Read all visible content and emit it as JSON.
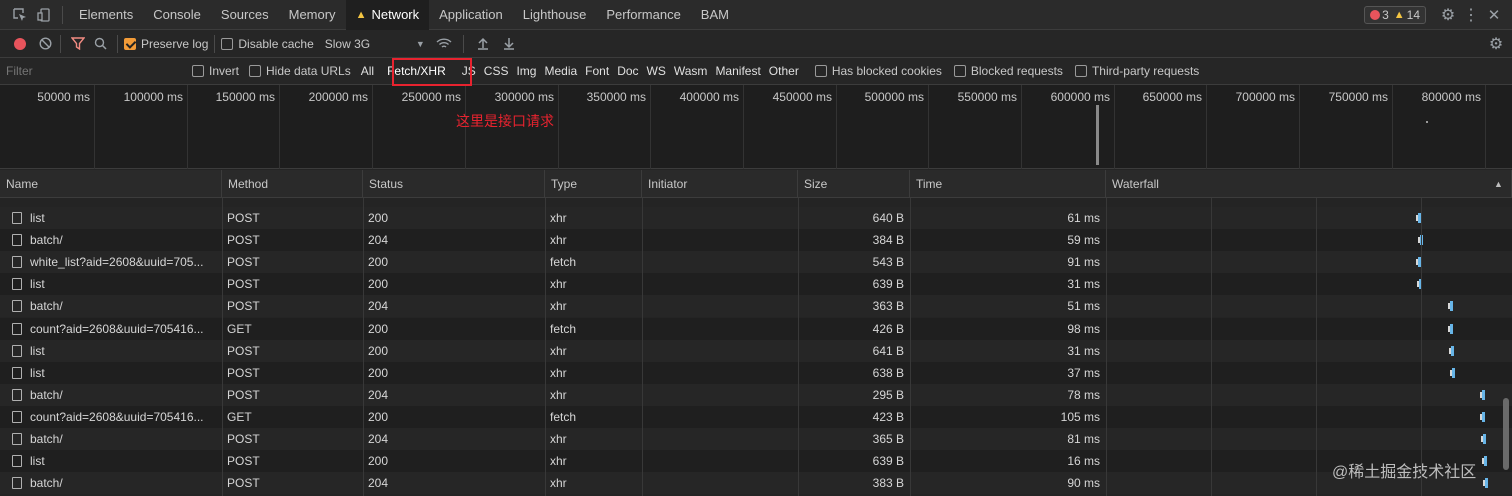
{
  "tabs": [
    "Elements",
    "Console",
    "Sources",
    "Memory",
    "Network",
    "Application",
    "Lighthouse",
    "Performance",
    "BAM"
  ],
  "active_tab": "Network",
  "badges": {
    "errors": "3",
    "warnings": "14"
  },
  "toolbar": {
    "preserve_log": "Preserve log",
    "disable_cache": "Disable cache",
    "throttle": "Slow 3G"
  },
  "filter": {
    "placeholder": "Filter",
    "invert": "Invert",
    "hide_data_urls": "Hide data URLs",
    "types": [
      "All",
      "Fetch/XHR",
      "JS",
      "CSS",
      "Img",
      "Media",
      "Font",
      "Doc",
      "WS",
      "Wasm",
      "Manifest",
      "Other"
    ],
    "selected_type": "Fetch/XHR",
    "has_blocked_cookies": "Has blocked cookies",
    "blocked_requests": "Blocked requests",
    "third_party": "Third-party requests"
  },
  "timeline_ticks": [
    "50000 ms",
    "100000 ms",
    "150000 ms",
    "200000 ms",
    "250000 ms",
    "300000 ms",
    "350000 ms",
    "400000 ms",
    "450000 ms",
    "500000 ms",
    "550000 ms",
    "600000 ms",
    "650000 ms",
    "700000 ms",
    "750000 ms",
    "800000 ms"
  ],
  "annotation": "这里是接口请求",
  "columns": [
    "Name",
    "Method",
    "Status",
    "Type",
    "Initiator",
    "Size",
    "Time",
    "Waterfall"
  ],
  "rows": [
    {
      "name": "list",
      "method": "POST",
      "status": "200",
      "type": "xhr",
      "initiator": "",
      "size": "640 B",
      "time": "61 ms"
    },
    {
      "name": "batch/",
      "method": "POST",
      "status": "204",
      "type": "xhr",
      "initiator": "",
      "size": "384 B",
      "time": "59 ms"
    },
    {
      "name": "white_list?aid=2608&uuid=705...",
      "method": "POST",
      "status": "200",
      "type": "fetch",
      "initiator": "",
      "size": "543 B",
      "time": "91 ms"
    },
    {
      "name": "list",
      "method": "POST",
      "status": "200",
      "type": "xhr",
      "initiator": "",
      "size": "639 B",
      "time": "31 ms"
    },
    {
      "name": "batch/",
      "method": "POST",
      "status": "204",
      "type": "xhr",
      "initiator": "",
      "size": "363 B",
      "time": "51 ms"
    },
    {
      "name": "count?aid=2608&uuid=705416...",
      "method": "GET",
      "status": "200",
      "type": "fetch",
      "initiator": "",
      "size": "426 B",
      "time": "98 ms"
    },
    {
      "name": "list",
      "method": "POST",
      "status": "200",
      "type": "xhr",
      "initiator": "",
      "size": "641 B",
      "time": "31 ms"
    },
    {
      "name": "list",
      "method": "POST",
      "status": "200",
      "type": "xhr",
      "initiator": "",
      "size": "638 B",
      "time": "37 ms"
    },
    {
      "name": "batch/",
      "method": "POST",
      "status": "204",
      "type": "xhr",
      "initiator": "",
      "size": "295 B",
      "time": "78 ms"
    },
    {
      "name": "count?aid=2608&uuid=705416...",
      "method": "GET",
      "status": "200",
      "type": "fetch",
      "initiator": "",
      "size": "423 B",
      "time": "105 ms"
    },
    {
      "name": "batch/",
      "method": "POST",
      "status": "204",
      "type": "xhr",
      "initiator": "",
      "size": "365 B",
      "time": "81 ms"
    },
    {
      "name": "list",
      "method": "POST",
      "status": "200",
      "type": "xhr",
      "initiator": "",
      "size": "639 B",
      "time": "16 ms"
    },
    {
      "name": "batch/",
      "method": "POST",
      "status": "204",
      "type": "xhr",
      "initiator": "",
      "size": "383 B",
      "time": "90 ms"
    }
  ],
  "watermark": "@稀土掘金技术社区"
}
